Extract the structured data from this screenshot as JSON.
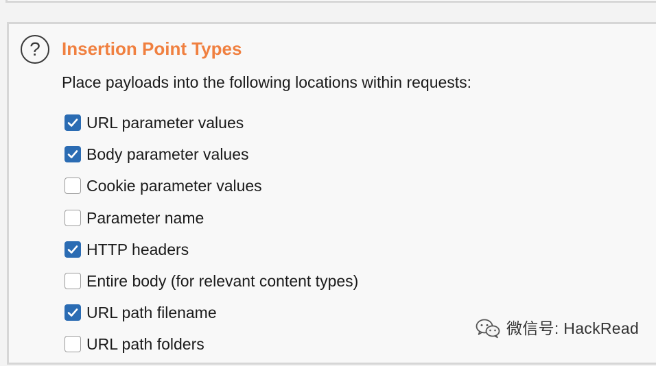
{
  "section": {
    "title": "Insertion Point Types",
    "description": "Place payloads into the following locations within requests:"
  },
  "icons": {
    "help": "?"
  },
  "options": [
    {
      "label": "URL parameter values",
      "checked": true
    },
    {
      "label": "Body parameter values",
      "checked": true
    },
    {
      "label": "Cookie parameter values",
      "checked": false
    },
    {
      "label": "Parameter name",
      "checked": false
    },
    {
      "label": "HTTP headers",
      "checked": true
    },
    {
      "label": "Entire body (for relevant content types)",
      "checked": false
    },
    {
      "label": "URL path filename",
      "checked": true
    },
    {
      "label": "URL path folders",
      "checked": false
    }
  ],
  "watermark": {
    "text": "微信号: HackRead"
  },
  "colors": {
    "title": "#f08040",
    "checkbox_checked": "#2b6cb3",
    "panel_background": "#f8f8f8",
    "panel_border": "#d6d6d6"
  }
}
